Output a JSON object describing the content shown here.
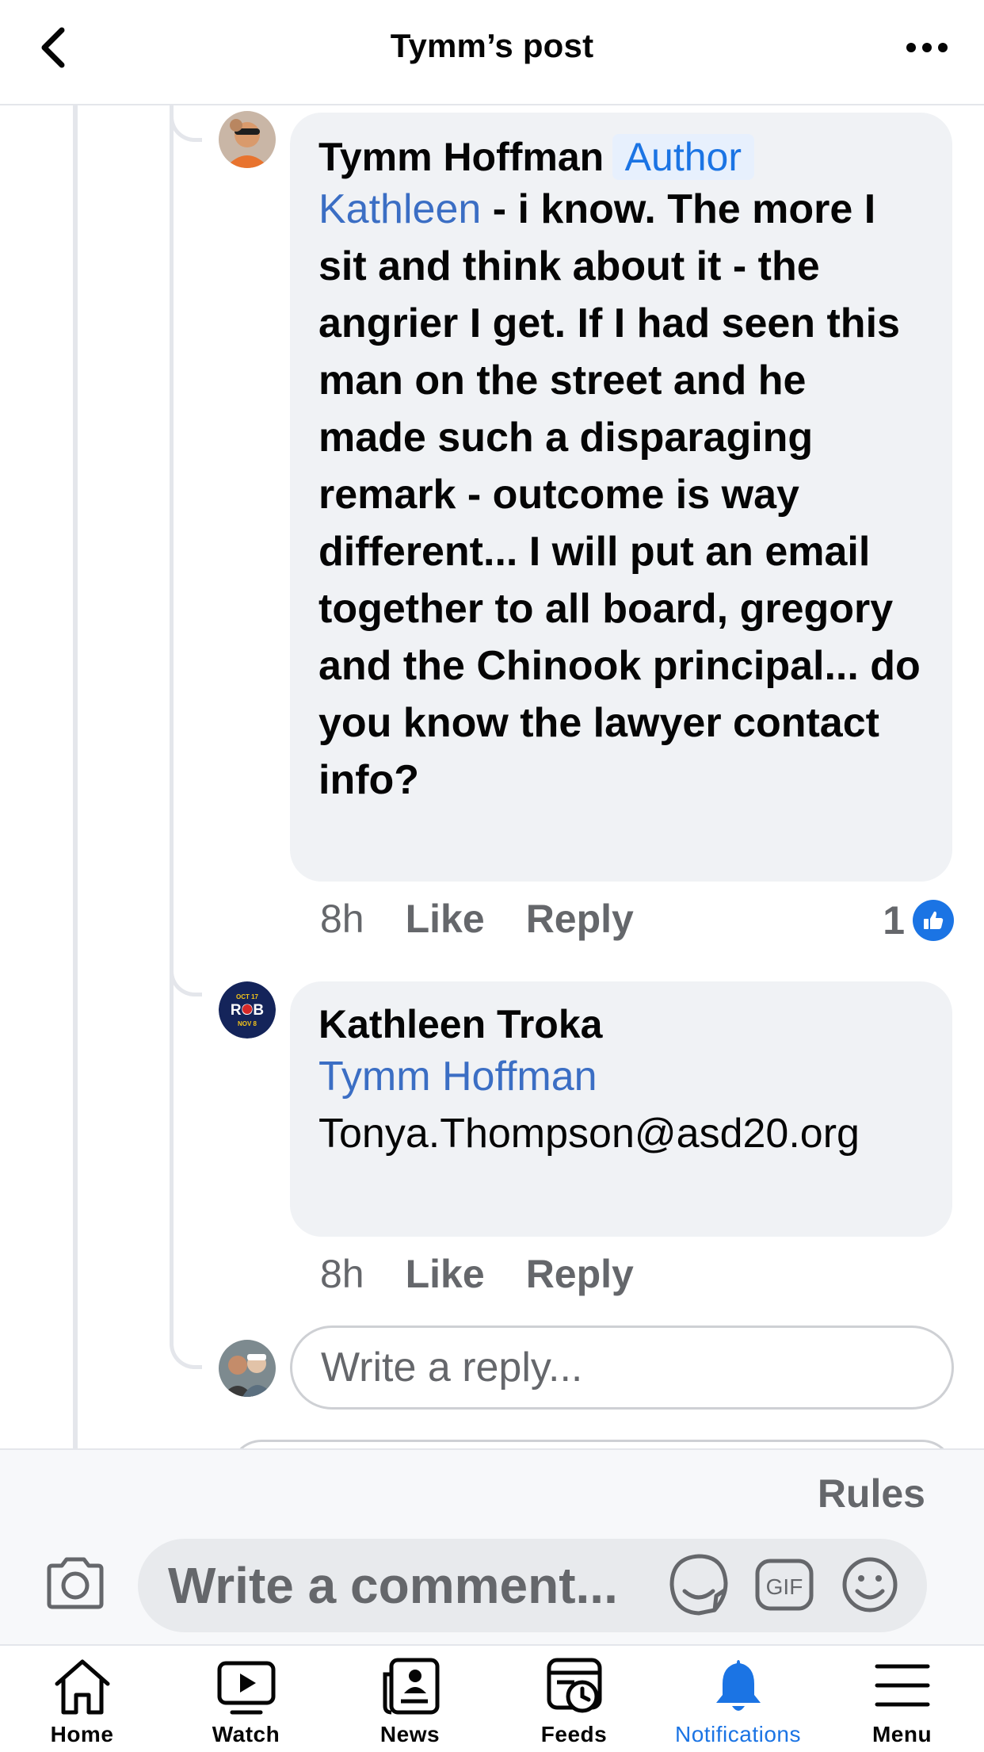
{
  "header": {
    "title": "Tymm’s post"
  },
  "comments": [
    {
      "name": "Tymm Hoffman",
      "badge": "Author",
      "mention": "Kathleen",
      "text": " - i know.  The more I sit and think about it - the angrier I get.  If I had seen this man on the street and he made such a disparaging remark - outcome is way different... I will put an email together to all board, gregory and the Chinook principal...  do you know the lawyer contact info?",
      "time": "8h",
      "like_label": "Like",
      "reply_label": "Reply",
      "reaction_count": "1"
    },
    {
      "name": "Kathleen Troka",
      "mention": "Tymm Hoffman",
      "text": "Tonya.Thompson@asd20.org",
      "time": "8h",
      "like_label": "Like",
      "reply_label": "Reply",
      "avatar_text": "ROB",
      "avatar_date_top": "OCT 17",
      "avatar_date_bottom": "NOV 8"
    }
  ],
  "reply_box": {
    "placeholder": "Write a reply..."
  },
  "comment_bar": {
    "rules_label": "Rules",
    "placeholder": "Write a comment...",
    "icons": [
      "camera-icon",
      "sticker-icon",
      "gif-icon",
      "emoji-icon"
    ],
    "gif_label": "GIF"
  },
  "tabs": [
    {
      "label": "Home",
      "icon": "home-icon"
    },
    {
      "label": "Watch",
      "icon": "watch-icon"
    },
    {
      "label": "News",
      "icon": "news-icon"
    },
    {
      "label": "Feeds",
      "icon": "feeds-icon"
    },
    {
      "label": "Notifications",
      "icon": "bell-icon",
      "active": true
    },
    {
      "label": "Menu",
      "icon": "menu-icon"
    }
  ],
  "colors": {
    "accent": "#1b74e4",
    "bubble": "#f0f2f5",
    "secondary_text": "#65676b"
  }
}
